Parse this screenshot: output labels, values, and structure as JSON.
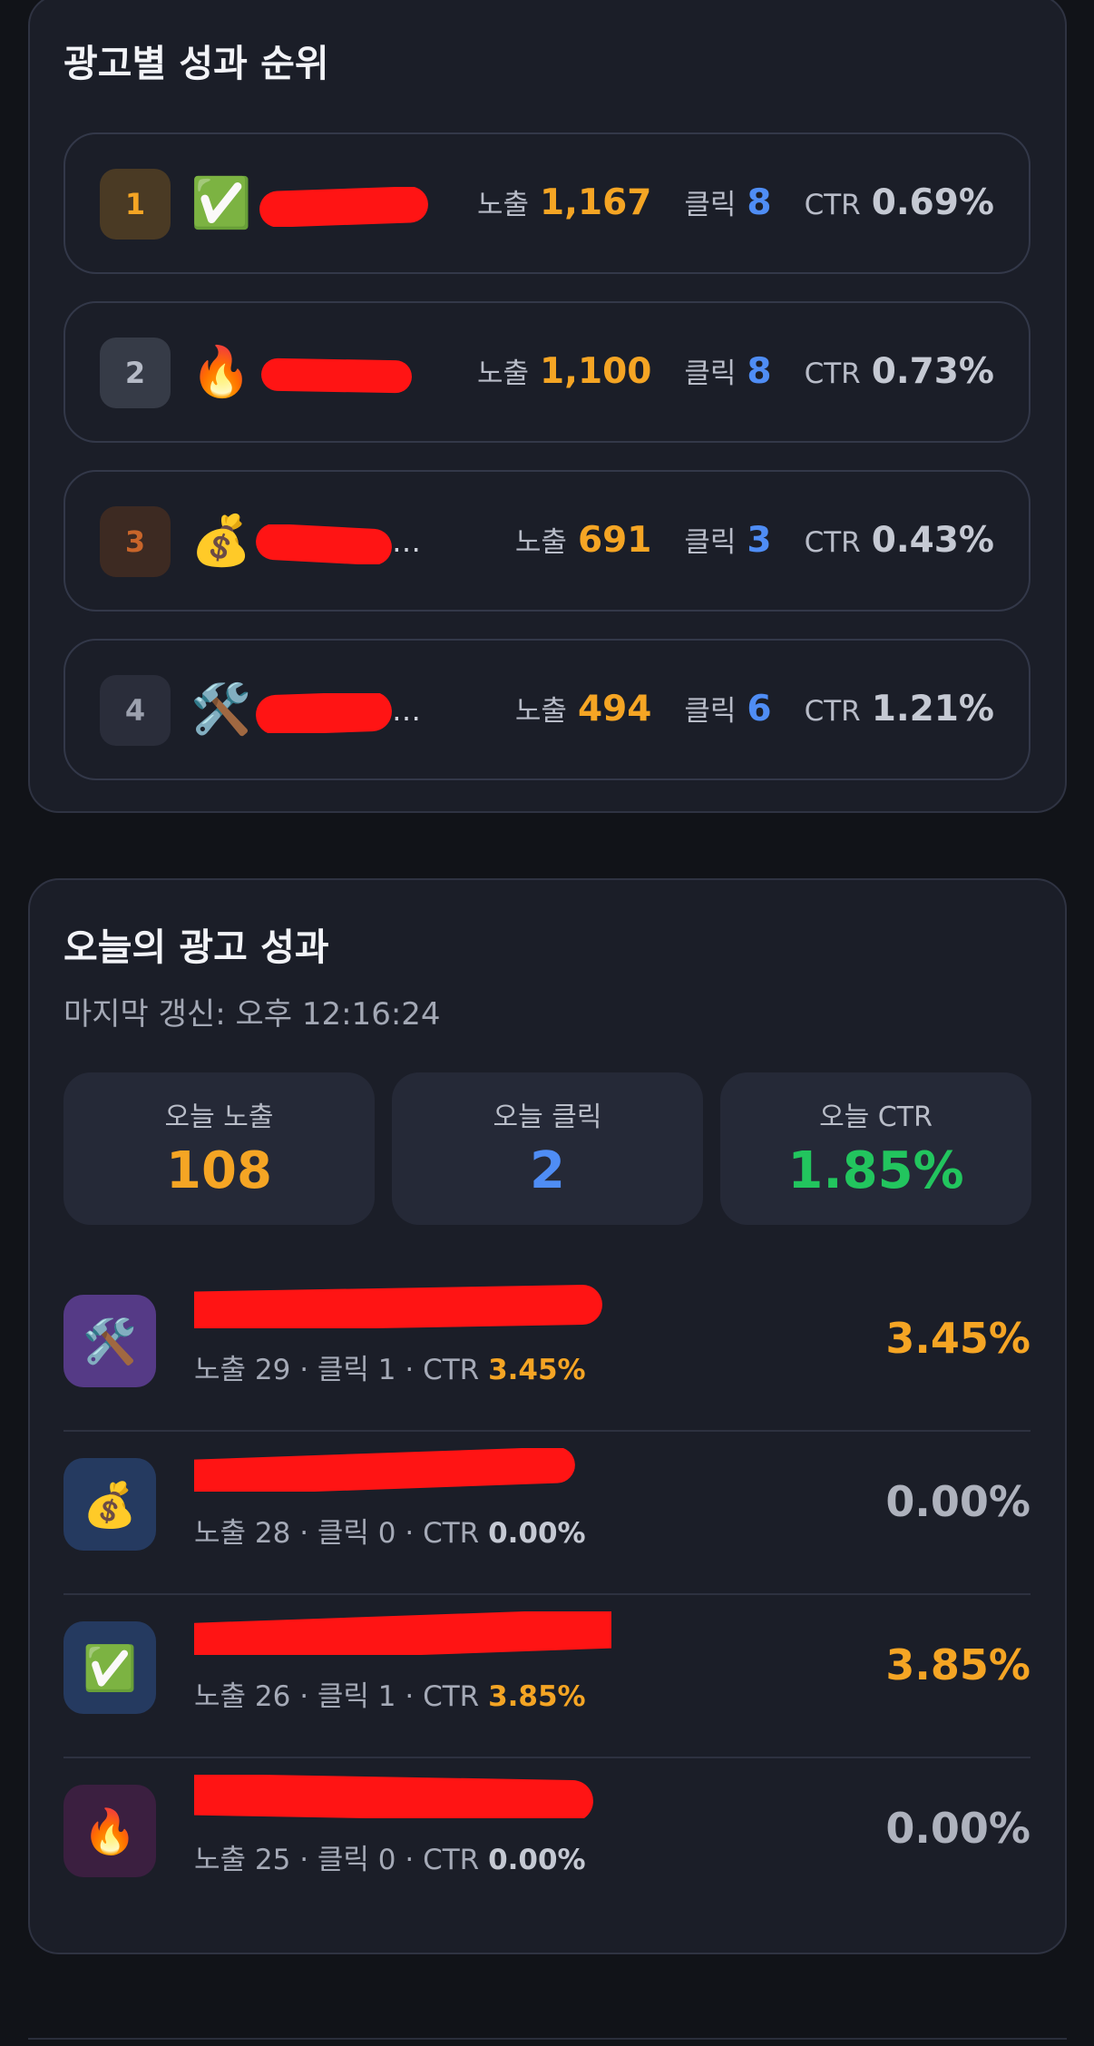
{
  "ranking": {
    "title": "광고별 성과 순위",
    "rows": [
      {
        "rank": "1",
        "emoji": "✅",
        "name": "",
        "impressions_label": "노출",
        "impressions": "1,167",
        "clicks_label": "클릭",
        "clicks": "8",
        "ctr_label": "CTR",
        "ctr": "0.69%",
        "badge_bg": "#4a3a24",
        "badge_color": "#f5a524"
      },
      {
        "rank": "2",
        "emoji": "🔥",
        "name": "",
        "impressions_label": "노출",
        "impressions": "1,100",
        "clicks_label": "클릭",
        "clicks": "8",
        "ctr_label": "CTR",
        "ctr": "0.73%",
        "badge_bg": "#363b47",
        "badge_color": "#b5bac6"
      },
      {
        "rank": "3",
        "emoji": "💰",
        "name": "…",
        "impressions_label": "노출",
        "impressions": "691",
        "clicks_label": "클릭",
        "clicks": "3",
        "ctr_label": "CTR",
        "ctr": "0.43%",
        "badge_bg": "#3d2a22",
        "badge_color": "#c8652a"
      },
      {
        "rank": "4",
        "emoji": "🛠️",
        "name": "…",
        "impressions_label": "노출",
        "impressions": "494",
        "clicks_label": "클릭",
        "clicks": "6",
        "ctr_label": "CTR",
        "ctr": "1.21%",
        "badge_bg": "#2a2d3a",
        "badge_color": "#9ca1ae"
      }
    ]
  },
  "today": {
    "title": "오늘의 광고 성과",
    "last_updated": "마지막 갱신: 오후 12:16:24",
    "kpis": [
      {
        "label": "오늘 노출",
        "value": "108",
        "color": "#f5a524"
      },
      {
        "label": "오늘 클릭",
        "value": "2",
        "color": "#4f8df5"
      },
      {
        "label": "오늘 CTR",
        "value": "1.85%",
        "color": "#22c55e"
      }
    ],
    "ads": [
      {
        "emoji": "🛠️",
        "icon_bg": "#553a86",
        "title": "",
        "impressions": "29",
        "clicks": "1",
        "ctr": "3.45%",
        "ctr_color": "#f5a524",
        "meta_prefix": "노출 29 · 클릭 1 · CTR "
      },
      {
        "emoji": "💰",
        "icon_bg": "#253a60",
        "title": "",
        "impressions": "28",
        "clicks": "0",
        "ctr": "0.00%",
        "ctr_color": "#aeb2bd",
        "meta_prefix": "노출 28 · 클릭 0 · CTR "
      },
      {
        "emoji": "✅",
        "icon_bg": "#253a60",
        "title": "",
        "impressions": "26",
        "clicks": "1",
        "ctr": "3.85%",
        "ctr_color": "#f5a524",
        "meta_prefix": "노출 26 · 클릭 1 · CTR "
      },
      {
        "emoji": "🔥",
        "icon_bg": "#3b1f40",
        "title": "",
        "impressions": "25",
        "clicks": "0",
        "ctr": "0.00%",
        "ctr_color": "#aeb2bd",
        "meta_prefix": "노출 25 · 클릭 0 · CTR "
      }
    ]
  }
}
